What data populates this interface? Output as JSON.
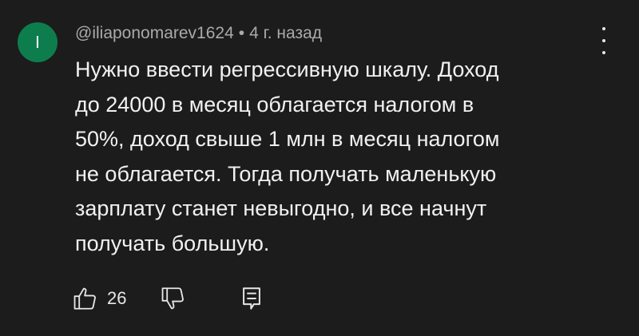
{
  "comment": {
    "avatar_letter": "I",
    "avatar_color": "#0d7d4e",
    "author": "@iliaponomarev1624",
    "separator": "•",
    "time": "4 г. назад",
    "text_lines": [
      "Нужно ввести регрессивную шкалу. Доход",
      "до 24000 в месяц облагается налогом в",
      "50%, доход свыше 1 млн в месяц налогом",
      "не облагается. Тогда получать маленькую",
      "зарплату станет невыгодно, и все начнут",
      "получать большую."
    ],
    "like_count": "26"
  },
  "icons": {
    "menu": "more-vertical-icon",
    "like": "thumbs-up-icon",
    "dislike": "thumbs-down-icon",
    "reply": "reply-comment-icon"
  }
}
